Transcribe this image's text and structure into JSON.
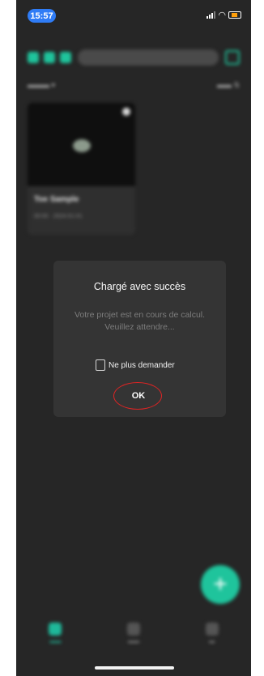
{
  "status_bar": {
    "time": "15:57"
  },
  "colors": {
    "accent": "#1fc49c",
    "time_pill": "#2f7cf6",
    "annotation_ring": "#e02424"
  },
  "background": {
    "card": {
      "title": "Toe Sample",
      "meta": "00:00 · 2024-01-01"
    }
  },
  "dialog": {
    "title": "Chargé avec succès",
    "message": "Votre projet est en cours de calcul. Veuillez attendre...",
    "checkbox_label": "Ne plus demander",
    "ok_label": "OK"
  },
  "fab": {
    "icon": "plus-icon"
  }
}
